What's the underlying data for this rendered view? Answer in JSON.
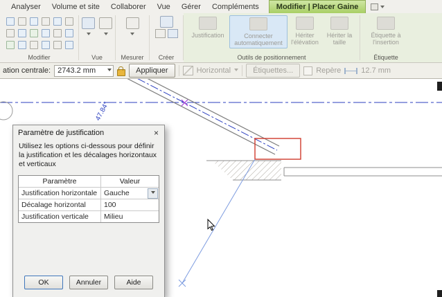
{
  "tabs": {
    "items": [
      "Analyser",
      "Volume et site",
      "Collaborer",
      "Vue",
      "Gérer",
      "Compléments"
    ],
    "contextual": "Modifier | Placer Gaine"
  },
  "ribbon": {
    "panel_labels": {
      "modifier": "Modifier",
      "vue": "Vue",
      "mesurer": "Mesurer",
      "creer": "Créer",
      "positionnement": "Outils de positionnement",
      "etiquette": "Étiquette"
    },
    "buttons": {
      "justification": "Justification",
      "connecter": "Connecter automatiquement",
      "heriter_elevation": "Hériter l'élévation",
      "heriter_taille": "Hériter la taille",
      "etiquette_insertion": "Étiquette à l'insertion"
    }
  },
  "options_bar": {
    "label": "ation centrale:",
    "value": "2743.2 mm",
    "apply": "Appliquer",
    "horizontal": "Horizontal",
    "etiquettes": "Étiquettes...",
    "repere": "Repère",
    "offset": "12.7 mm"
  },
  "canvas": {
    "angle_label": "47.84°"
  },
  "dialog": {
    "title": "Paramètre de justification",
    "close": "×",
    "description": "Utilisez les options ci-dessous pour définir la justification et les décalages horizontaux et verticaux",
    "table": {
      "headers": [
        "Paramètre",
        "Valeur"
      ],
      "rows": [
        {
          "param": "Justification horizontale",
          "value": "Gauche"
        },
        {
          "param": "Décalage horizontal",
          "value": "100"
        },
        {
          "param": "Justification verticale",
          "value": "Milieu"
        }
      ]
    },
    "buttons": {
      "ok": "OK",
      "cancel": "Annuler",
      "help": "Aide"
    }
  },
  "colors": {
    "contextual_tab_green": "#a9cf65",
    "highlight_blue": "#d9e8f6",
    "selection_red": "#d03a2c",
    "centerline_blue": "#2b3fbf",
    "leader_blue": "#7d9ce0",
    "snap_purple": "#a23bd6"
  }
}
